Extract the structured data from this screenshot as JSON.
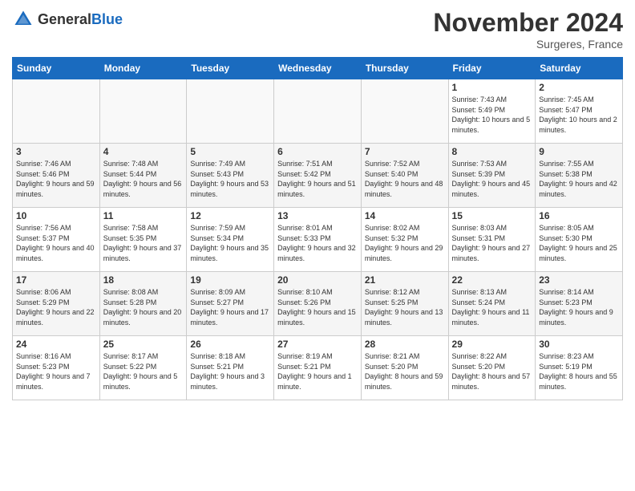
{
  "header": {
    "logo_general": "General",
    "logo_blue": "Blue",
    "month_title": "November 2024",
    "location": "Surgeres, France"
  },
  "weekdays": [
    "Sunday",
    "Monday",
    "Tuesday",
    "Wednesday",
    "Thursday",
    "Friday",
    "Saturday"
  ],
  "weeks": [
    [
      {
        "day": "",
        "sunrise": "",
        "sunset": "",
        "daylight": ""
      },
      {
        "day": "",
        "sunrise": "",
        "sunset": "",
        "daylight": ""
      },
      {
        "day": "",
        "sunrise": "",
        "sunset": "",
        "daylight": ""
      },
      {
        "day": "",
        "sunrise": "",
        "sunset": "",
        "daylight": ""
      },
      {
        "day": "",
        "sunrise": "",
        "sunset": "",
        "daylight": ""
      },
      {
        "day": "1",
        "sunrise": "Sunrise: 7:43 AM",
        "sunset": "Sunset: 5:49 PM",
        "daylight": "Daylight: 10 hours and 5 minutes."
      },
      {
        "day": "2",
        "sunrise": "Sunrise: 7:45 AM",
        "sunset": "Sunset: 5:47 PM",
        "daylight": "Daylight: 10 hours and 2 minutes."
      }
    ],
    [
      {
        "day": "3",
        "sunrise": "Sunrise: 7:46 AM",
        "sunset": "Sunset: 5:46 PM",
        "daylight": "Daylight: 9 hours and 59 minutes."
      },
      {
        "day": "4",
        "sunrise": "Sunrise: 7:48 AM",
        "sunset": "Sunset: 5:44 PM",
        "daylight": "Daylight: 9 hours and 56 minutes."
      },
      {
        "day": "5",
        "sunrise": "Sunrise: 7:49 AM",
        "sunset": "Sunset: 5:43 PM",
        "daylight": "Daylight: 9 hours and 53 minutes."
      },
      {
        "day": "6",
        "sunrise": "Sunrise: 7:51 AM",
        "sunset": "Sunset: 5:42 PM",
        "daylight": "Daylight: 9 hours and 51 minutes."
      },
      {
        "day": "7",
        "sunrise": "Sunrise: 7:52 AM",
        "sunset": "Sunset: 5:40 PM",
        "daylight": "Daylight: 9 hours and 48 minutes."
      },
      {
        "day": "8",
        "sunrise": "Sunrise: 7:53 AM",
        "sunset": "Sunset: 5:39 PM",
        "daylight": "Daylight: 9 hours and 45 minutes."
      },
      {
        "day": "9",
        "sunrise": "Sunrise: 7:55 AM",
        "sunset": "Sunset: 5:38 PM",
        "daylight": "Daylight: 9 hours and 42 minutes."
      }
    ],
    [
      {
        "day": "10",
        "sunrise": "Sunrise: 7:56 AM",
        "sunset": "Sunset: 5:37 PM",
        "daylight": "Daylight: 9 hours and 40 minutes."
      },
      {
        "day": "11",
        "sunrise": "Sunrise: 7:58 AM",
        "sunset": "Sunset: 5:35 PM",
        "daylight": "Daylight: 9 hours and 37 minutes."
      },
      {
        "day": "12",
        "sunrise": "Sunrise: 7:59 AM",
        "sunset": "Sunset: 5:34 PM",
        "daylight": "Daylight: 9 hours and 35 minutes."
      },
      {
        "day": "13",
        "sunrise": "Sunrise: 8:01 AM",
        "sunset": "Sunset: 5:33 PM",
        "daylight": "Daylight: 9 hours and 32 minutes."
      },
      {
        "day": "14",
        "sunrise": "Sunrise: 8:02 AM",
        "sunset": "Sunset: 5:32 PM",
        "daylight": "Daylight: 9 hours and 29 minutes."
      },
      {
        "day": "15",
        "sunrise": "Sunrise: 8:03 AM",
        "sunset": "Sunset: 5:31 PM",
        "daylight": "Daylight: 9 hours and 27 minutes."
      },
      {
        "day": "16",
        "sunrise": "Sunrise: 8:05 AM",
        "sunset": "Sunset: 5:30 PM",
        "daylight": "Daylight: 9 hours and 25 minutes."
      }
    ],
    [
      {
        "day": "17",
        "sunrise": "Sunrise: 8:06 AM",
        "sunset": "Sunset: 5:29 PM",
        "daylight": "Daylight: 9 hours and 22 minutes."
      },
      {
        "day": "18",
        "sunrise": "Sunrise: 8:08 AM",
        "sunset": "Sunset: 5:28 PM",
        "daylight": "Daylight: 9 hours and 20 minutes."
      },
      {
        "day": "19",
        "sunrise": "Sunrise: 8:09 AM",
        "sunset": "Sunset: 5:27 PM",
        "daylight": "Daylight: 9 hours and 17 minutes."
      },
      {
        "day": "20",
        "sunrise": "Sunrise: 8:10 AM",
        "sunset": "Sunset: 5:26 PM",
        "daylight": "Daylight: 9 hours and 15 minutes."
      },
      {
        "day": "21",
        "sunrise": "Sunrise: 8:12 AM",
        "sunset": "Sunset: 5:25 PM",
        "daylight": "Daylight: 9 hours and 13 minutes."
      },
      {
        "day": "22",
        "sunrise": "Sunrise: 8:13 AM",
        "sunset": "Sunset: 5:24 PM",
        "daylight": "Daylight: 9 hours and 11 minutes."
      },
      {
        "day": "23",
        "sunrise": "Sunrise: 8:14 AM",
        "sunset": "Sunset: 5:23 PM",
        "daylight": "Daylight: 9 hours and 9 minutes."
      }
    ],
    [
      {
        "day": "24",
        "sunrise": "Sunrise: 8:16 AM",
        "sunset": "Sunset: 5:23 PM",
        "daylight": "Daylight: 9 hours and 7 minutes."
      },
      {
        "day": "25",
        "sunrise": "Sunrise: 8:17 AM",
        "sunset": "Sunset: 5:22 PM",
        "daylight": "Daylight: 9 hours and 5 minutes."
      },
      {
        "day": "26",
        "sunrise": "Sunrise: 8:18 AM",
        "sunset": "Sunset: 5:21 PM",
        "daylight": "Daylight: 9 hours and 3 minutes."
      },
      {
        "day": "27",
        "sunrise": "Sunrise: 8:19 AM",
        "sunset": "Sunset: 5:21 PM",
        "daylight": "Daylight: 9 hours and 1 minute."
      },
      {
        "day": "28",
        "sunrise": "Sunrise: 8:21 AM",
        "sunset": "Sunset: 5:20 PM",
        "daylight": "Daylight: 8 hours and 59 minutes."
      },
      {
        "day": "29",
        "sunrise": "Sunrise: 8:22 AM",
        "sunset": "Sunset: 5:20 PM",
        "daylight": "Daylight: 8 hours and 57 minutes."
      },
      {
        "day": "30",
        "sunrise": "Sunrise: 8:23 AM",
        "sunset": "Sunset: 5:19 PM",
        "daylight": "Daylight: 8 hours and 55 minutes."
      }
    ]
  ]
}
